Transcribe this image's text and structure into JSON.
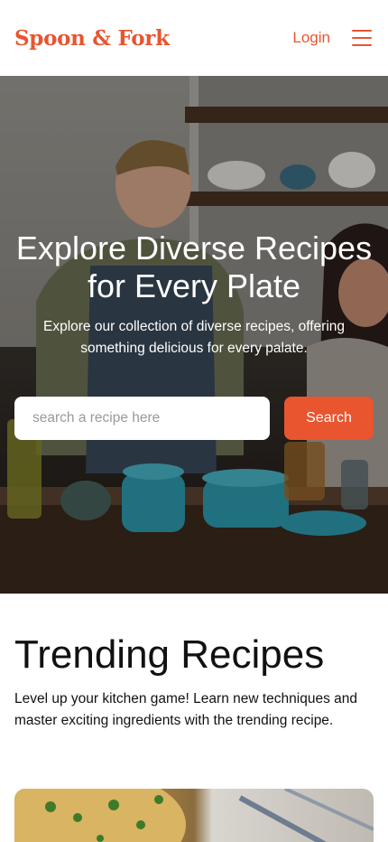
{
  "header": {
    "logo": "Spoon & Fork",
    "login_label": "Login",
    "menu_icon": "hamburger-menu-icon"
  },
  "hero": {
    "title": "Explore Diverse Recipes for Every Plate",
    "subtitle": "Explore our collection of diverse recipes, offering something delicious for every palate.",
    "search_placeholder": "search a recipe here",
    "search_button": "Search"
  },
  "trending": {
    "title": "Trending Recipes",
    "description": "Level up your kitchen game! Learn new techniques and master exciting ingredients with the trending recipe."
  },
  "colors": {
    "brand": "#e8552f",
    "text": "#111111",
    "background": "#ffffff"
  }
}
